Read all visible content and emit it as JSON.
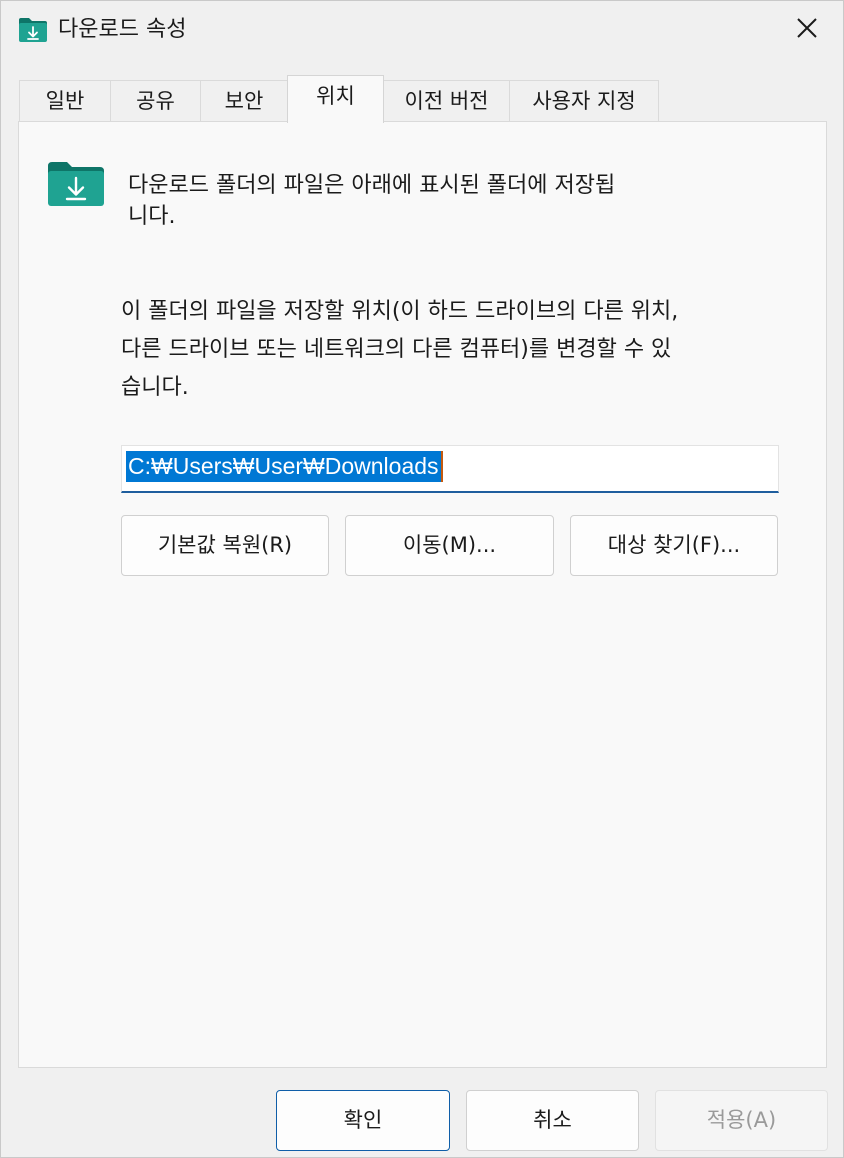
{
  "window": {
    "title": "다운로드 속성",
    "close_glyph": "✕",
    "title_icon": "download-folder-icon"
  },
  "tabs": [
    {
      "label": "일반",
      "active": false
    },
    {
      "label": "공유",
      "active": false
    },
    {
      "label": "보안",
      "active": false
    },
    {
      "label": "위치",
      "active": true
    },
    {
      "label": "이전 버전",
      "active": false
    },
    {
      "label": "사용자 지정",
      "active": false
    }
  ],
  "location": {
    "header_line1": "다운로드 폴더의 파일은 아래에 표시된 폴더에 저장됩",
    "header_line2": "니다.",
    "desc_line1": "이 폴더의 파일을 저장할 위치(이 하드 드라이브의 다른 위치,",
    "desc_line2": "다른 드라이브 또는 네트워크의 다른 컴퓨터)를 변경할 수 있",
    "desc_line3": "습니다.",
    "path_value": "C:₩Users₩User₩Downloads",
    "restore_label": "기본값 복원(R)",
    "move_label": "이동(M)...",
    "find_target_label": "대상 찾기(F)..."
  },
  "footer": {
    "ok_label": "확인",
    "cancel_label": "취소",
    "apply_label": "적용(A)"
  },
  "colors": {
    "accent": "#0078d4",
    "folder_teal": "#1a9c8c",
    "folder_teal_dark": "#0e7568"
  }
}
